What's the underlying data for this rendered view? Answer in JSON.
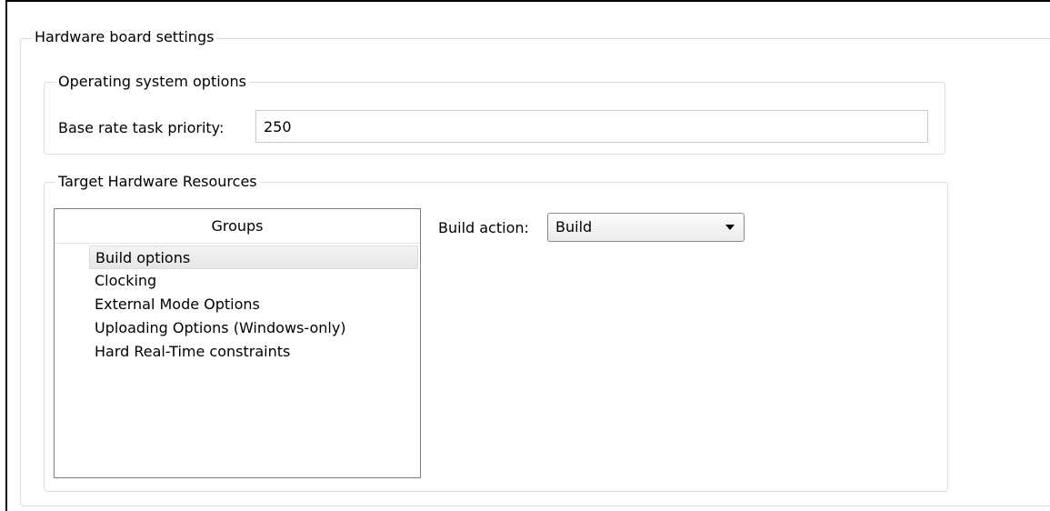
{
  "hardware_board_settings": {
    "title": "Hardware board settings",
    "operating_system_options": {
      "title": "Operating system options",
      "base_rate_label": "Base rate task priority:",
      "base_rate_value": "250"
    },
    "target_hardware_resources": {
      "title": "Target Hardware Resources",
      "groups_header": "Groups",
      "groups": [
        {
          "label": "Build options",
          "selected": true
        },
        {
          "label": "Clocking",
          "selected": false
        },
        {
          "label": "External Mode Options",
          "selected": false
        },
        {
          "label": "Uploading Options (Windows-only)",
          "selected": false
        },
        {
          "label": "Hard Real-Time constraints",
          "selected": false
        }
      ],
      "build_action_label": "Build action:",
      "build_action_value": "Build",
      "dropdown_icon": "chevron-down-icon"
    }
  }
}
